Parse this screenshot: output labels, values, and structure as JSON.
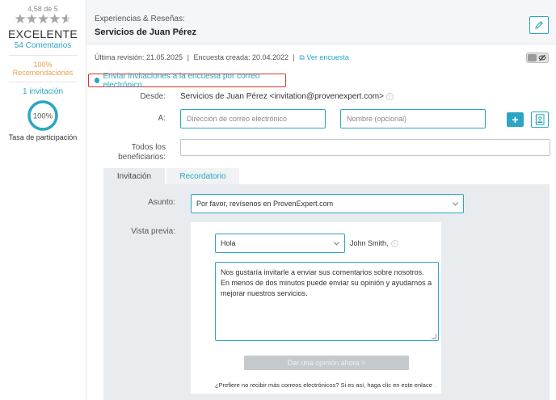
{
  "sidebar": {
    "rating_text": "4,58 de 5",
    "stars": "★★★★★",
    "stars_value": 4.58,
    "rating_word": "EXCELENTE",
    "comments": "54 Comentarios",
    "recommend_percent": "100%",
    "recommend_label": "Recomendaciones",
    "invite_count": "1 invitación",
    "participation_percent": "100%",
    "participation_fraction": 1.0,
    "participation_label": "Tasa de participación"
  },
  "header": {
    "subtitle": "Experiencias & Reseñas:",
    "title": "Servicios de Juan Pérez",
    "edit_icon": "pencil-icon"
  },
  "meta": {
    "last_revision": "Última revisión: 21.05.2025",
    "separator": "|",
    "created": "Encuesta creada: 20.04.2022",
    "view_survey": "Ver encuesta",
    "visibility_icon": "eye-slash-icon"
  },
  "invite_section": {
    "title": "Enviar invitaciones a la encuesta por correo electrónico"
  },
  "form": {
    "from_label": "Desde:",
    "from_value": "Servicios de Juan Pérez <invitation@provenexpert.com>",
    "to_label": "A:",
    "email_placeholder": "Dirección de correo electrónico",
    "name_placeholder": "Nombre (opcional)",
    "add_button": "+",
    "all_label_line1": "Todos los",
    "all_label_line2": "beneficiarios:"
  },
  "tabs": {
    "invitation": "Invitación",
    "reminder": "Recordatorio"
  },
  "email": {
    "subject_label": "Asunto:",
    "subject_value": "Por favor, revísenos en ProvenExpert.com",
    "preview_label": "Vista previa:",
    "greeting_value": "Hola",
    "greeting_name": "John Smith,",
    "body": "Nos gustaría invitarle a enviar sus comentarios sobre nosotros. En menos de dos minutos puede enviar su opinión y ayudarnos a mejorar nuestros servicios.",
    "cta": "Dar una opinión ahora >",
    "unsubscribe_text": "¿Prefiere no recibir más correos electrónicos? Si es así, haga clic en este enlace",
    "unsubscribe_link": "."
  },
  "colors": {
    "accent": "#2aa6c4",
    "highlight_border": "#d9362b",
    "recommend": "#e8a04c"
  }
}
